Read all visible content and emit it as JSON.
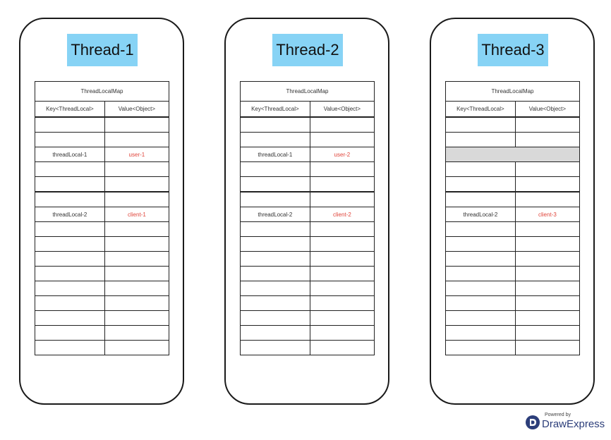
{
  "threads": [
    {
      "title": "Thread-1",
      "map_title": "ThreadLocalMap",
      "key_header": "Key<ThreadLocal>",
      "value_header": "Value<Object>",
      "rows": [
        {
          "key": "",
          "value": ""
        },
        {
          "key": "",
          "value": ""
        },
        {
          "key": "threadLocal-1",
          "value": "user-1"
        },
        {
          "key": "",
          "value": ""
        },
        {
          "key": "",
          "value": ""
        },
        {
          "key": "",
          "value": ""
        },
        {
          "key": "threadLocal-2",
          "value": "client-1"
        },
        {
          "key": "",
          "value": ""
        },
        {
          "key": "",
          "value": ""
        },
        {
          "key": "",
          "value": ""
        },
        {
          "key": "",
          "value": ""
        },
        {
          "key": "",
          "value": ""
        },
        {
          "key": "",
          "value": ""
        },
        {
          "key": "",
          "value": ""
        },
        {
          "key": "",
          "value": ""
        },
        {
          "key": "",
          "value": ""
        }
      ]
    },
    {
      "title": "Thread-2",
      "map_title": "ThreadLocalMap",
      "key_header": "Key<ThreadLocal>",
      "value_header": "Value<Object>",
      "rows": [
        {
          "key": "",
          "value": ""
        },
        {
          "key": "",
          "value": ""
        },
        {
          "key": "threadLocal-1",
          "value": "user-2"
        },
        {
          "key": "",
          "value": ""
        },
        {
          "key": "",
          "value": ""
        },
        {
          "key": "",
          "value": ""
        },
        {
          "key": "threadLocal-2",
          "value": "client-2"
        },
        {
          "key": "",
          "value": ""
        },
        {
          "key": "",
          "value": ""
        },
        {
          "key": "",
          "value": ""
        },
        {
          "key": "",
          "value": ""
        },
        {
          "key": "",
          "value": ""
        },
        {
          "key": "",
          "value": ""
        },
        {
          "key": "",
          "value": ""
        },
        {
          "key": "",
          "value": ""
        },
        {
          "key": "",
          "value": ""
        }
      ]
    },
    {
      "title": "Thread-3",
      "map_title": "ThreadLocalMap",
      "key_header": "Key<ThreadLocal>",
      "value_header": "Value<Object>",
      "rows": [
        {
          "key": "",
          "value": ""
        },
        {
          "key": "",
          "value": ""
        },
        {
          "key": "",
          "value": "",
          "highlighted": true
        },
        {
          "key": "",
          "value": ""
        },
        {
          "key": "",
          "value": ""
        },
        {
          "key": "",
          "value": ""
        },
        {
          "key": "threadLocal-2",
          "value": "client-3"
        },
        {
          "key": "",
          "value": ""
        },
        {
          "key": "",
          "value": ""
        },
        {
          "key": "",
          "value": ""
        },
        {
          "key": "",
          "value": ""
        },
        {
          "key": "",
          "value": ""
        },
        {
          "key": "",
          "value": ""
        },
        {
          "key": "",
          "value": ""
        },
        {
          "key": "",
          "value": ""
        },
        {
          "key": "",
          "value": ""
        }
      ]
    }
  ],
  "colors": {
    "title_bg": "#87d3f5",
    "value_text": "#e0453b",
    "highlight_row": "#d9d9d9",
    "brand": "#2c3e7a"
  },
  "brand": {
    "powered_by": "Powered by",
    "name": "DrawExpress",
    "icon": "drawexpress-logo-icon"
  }
}
